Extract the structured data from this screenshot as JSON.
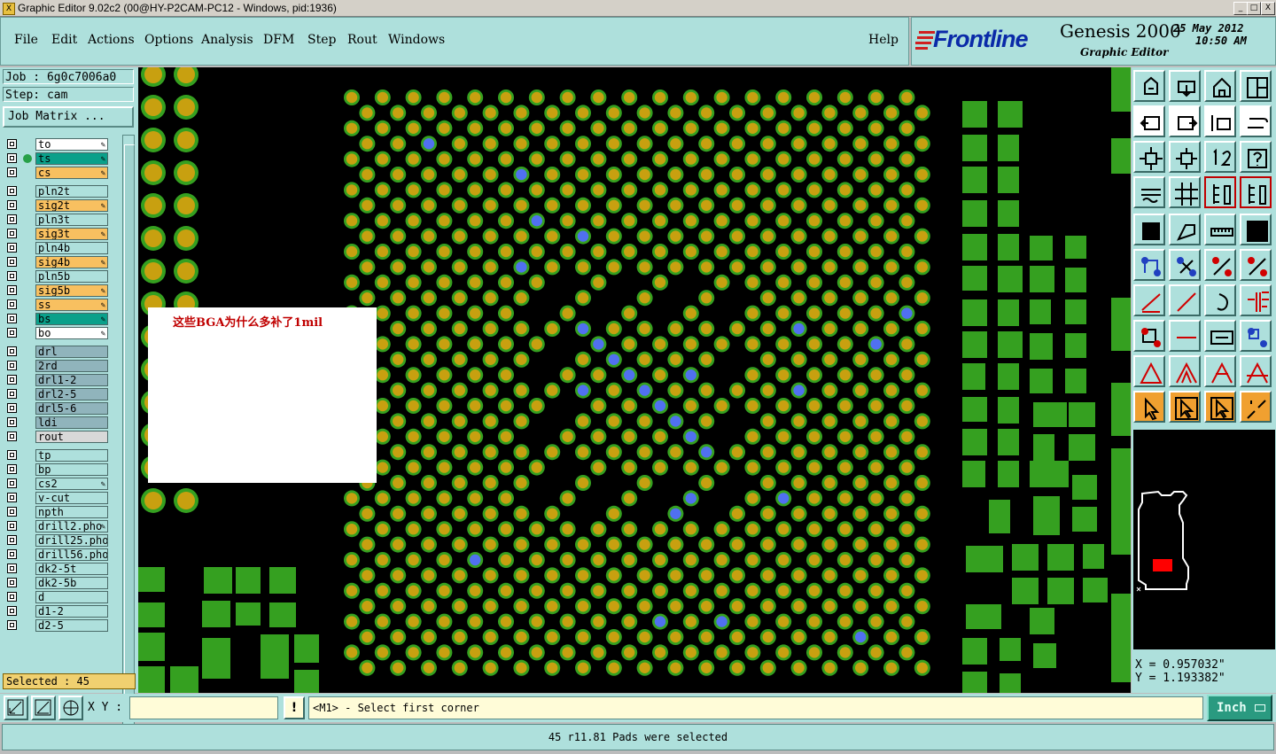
{
  "window": {
    "title": "Graphic Editor 9.02c2 (00@HY-P2CAM-PC12 - Windows, pid:1936)",
    "buttons": {
      "minimize": "_",
      "maximize": "□",
      "close": "X"
    }
  },
  "menu": {
    "items": [
      "File",
      "Edit",
      "Actions",
      "Options",
      "Analysis",
      "DFM",
      "Step",
      "Rout",
      "Windows"
    ],
    "help": "Help"
  },
  "brand": {
    "logo": "Frontline",
    "product": "Genesis 2000",
    "subtitle": "Graphic Editor",
    "date": "25 May 2012",
    "time": "10:50 AM"
  },
  "job": {
    "job_label": "Job  :  6g0c7006a0",
    "step_label": "Step:  cam",
    "matrix_button": "Job Matrix ..."
  },
  "layers": [
    {
      "name": "to",
      "color": "#ffffff",
      "editable": true
    },
    {
      "name": "ts",
      "color": "#0aa08a",
      "editable": true,
      "active": true
    },
    {
      "name": "cs",
      "color": "#f8c060",
      "editable": true
    },
    {
      "name": "pln2t",
      "color": "#aee0dc",
      "editable": false
    },
    {
      "name": "sig2t",
      "color": "#f8c060",
      "editable": true
    },
    {
      "name": "pln3t",
      "color": "#aee0dc",
      "editable": false
    },
    {
      "name": "sig3t",
      "color": "#f8c060",
      "editable": true
    },
    {
      "name": "pln4b",
      "color": "#aee0dc",
      "editable": false
    },
    {
      "name": "sig4b",
      "color": "#f8c060",
      "editable": true
    },
    {
      "name": "pln5b",
      "color": "#aee0dc",
      "editable": false
    },
    {
      "name": "sig5b",
      "color": "#f8c060",
      "editable": true
    },
    {
      "name": "ss",
      "color": "#f8c060",
      "editable": true
    },
    {
      "name": "bs",
      "color": "#0aa08a",
      "editable": true
    },
    {
      "name": "bo",
      "color": "#ffffff",
      "editable": true
    },
    {
      "name": "drl",
      "color": "#90b4bc",
      "editable": false
    },
    {
      "name": "2rd",
      "color": "#90b4bc",
      "editable": false
    },
    {
      "name": "drl1-2",
      "color": "#90b4bc",
      "editable": false
    },
    {
      "name": "drl2-5",
      "color": "#90b4bc",
      "editable": false
    },
    {
      "name": "drl5-6",
      "color": "#90b4bc",
      "editable": false
    },
    {
      "name": "ldi",
      "color": "#90b4bc",
      "editable": false
    },
    {
      "name": "rout",
      "color": "#d8d8d8",
      "editable": false
    },
    {
      "name": "tp",
      "color": "#aee0dc",
      "editable": false
    },
    {
      "name": "bp",
      "color": "#aee0dc",
      "editable": false
    },
    {
      "name": "cs2",
      "color": "#aee0dc",
      "editable": true
    },
    {
      "name": "v-cut",
      "color": "#aee0dc",
      "editable": false
    },
    {
      "name": "npth",
      "color": "#aee0dc",
      "editable": false
    },
    {
      "name": "drill2.pho",
      "color": "#aee0dc",
      "editable": true
    },
    {
      "name": "drill25.pho",
      "color": "#aee0dc",
      "editable": false
    },
    {
      "name": "drill56.pho",
      "color": "#aee0dc",
      "editable": false
    },
    {
      "name": "dk2-5t",
      "color": "#aee0dc",
      "editable": false
    },
    {
      "name": "dk2-5b",
      "color": "#aee0dc",
      "editable": false
    },
    {
      "name": "d",
      "color": "#aee0dc",
      "editable": false
    },
    {
      "name": "d1-2",
      "color": "#aee0dc",
      "editable": false
    },
    {
      "name": "d2-5",
      "color": "#aee0dc",
      "editable": false
    }
  ],
  "selection": {
    "label": "Selected : 45"
  },
  "canvas": {
    "note_text": "这些BGA为什么多补了1mil",
    "colors": {
      "pad_ring": "#35a020",
      "pad_center": "#c8a010",
      "selected_pad": "#5070f0",
      "background": "#000000"
    }
  },
  "toolbox": {
    "icons": [
      "zoom-home-icon",
      "zoom-back-icon",
      "home-icon",
      "window-layout-icon",
      "pan-left-icon",
      "pan-right-icon",
      "undo-zoom-icon",
      "redo-zoom-icon",
      "fit-all-icon",
      "fit-profile-icon",
      "scale-1-2-icon",
      "help-query-icon",
      "ruler-snap-icon",
      "grid-icon",
      "layer-display-icon",
      "layer-compare-icon",
      "pad-icon",
      "shape-icon",
      "measure-icon",
      "surface-icon",
      "connect-icon",
      "cross-icon",
      "line-point-icon",
      "arc-point-icon",
      "angle-line-icon",
      "diagonal-line-icon",
      "arc-icon",
      "split-icon",
      "select-point-icon",
      "trim-icon",
      "dimension-icon",
      "group-icon",
      "triangle-a-icon",
      "triangle-b-icon",
      "triangle-c-icon",
      "triangle-d-icon",
      "pointer-icon",
      "pointer-select-icon",
      "pointer-area-icon",
      "pointer-net-icon"
    ]
  },
  "coords": {
    "x": "X = 0.957032\"",
    "y": "Y = 1.193382\""
  },
  "command": {
    "xy_label": "X Y :",
    "xy_value": "",
    "warn": "!",
    "prompt": "<M1> - Select first corner",
    "units": "Inch"
  },
  "status": {
    "message": "45 r11.81 Pads were selected"
  }
}
